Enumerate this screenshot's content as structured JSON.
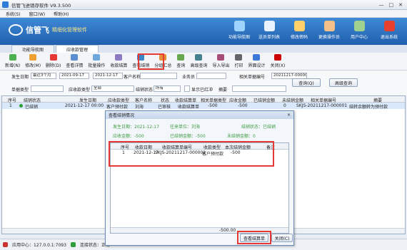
{
  "app": {
    "title": "信管飞进销存软件 V9.3.500",
    "menu": [
      "系统(S)",
      "窗口(W)",
      "帮助(H)"
    ]
  },
  "banner": {
    "brand": "信管飞",
    "slogan": "精细化管理软件",
    "buttons": [
      "功能导航图",
      "送员单列表",
      "修改密码",
      "更换操作员",
      "用户中心",
      "退出系统"
    ]
  },
  "tabs": [
    "功能导航图",
    "应收款管理"
  ],
  "toolbar": {
    "buttons": [
      "新增(N)",
      "修改(M)",
      "删除(D)",
      "查看详情",
      "批量操作",
      "收款结算",
      "查看结销",
      "分组汇总",
      "查询",
      "高级查询",
      "导入导出",
      "打印",
      "界面设计",
      "关闭(X)"
    ]
  },
  "filter": {
    "date_label": "发生日期",
    "date_range": "最近3个月",
    "date_from": "2021-09-17",
    "date_to": "2021-12-17",
    "customer_label": "客户名称",
    "salesman_label": "业务员",
    "ref_label": "相关单据编号",
    "ref_value": "20211217-000001",
    "query_btn": "查询(Q)",
    "adv_btn": "高级查询",
    "doc_type_label": "单据类型",
    "recv_type_label": "应收款类型",
    "recv_type_value": "全部",
    "status_label": "结销状态",
    "status_value": "所有",
    "show_label": "显示已红冲",
    "remark_label": "摘要"
  },
  "table": {
    "headers": [
      "序号",
      "结销状态",
      "发生日期",
      "应收款类型",
      "客户名称",
      "状态",
      "收款结算单",
      "相关单据类型",
      "应收金额",
      "已结销金额",
      "未结销金额",
      "相关单据编号",
      "摘要"
    ],
    "rows": [
      [
        "1",
        "已结销",
        "2021-12-17 00:00",
        "客户预付款",
        "刘海",
        "已审核",
        "收款结算单",
        "-500",
        "-500",
        "0",
        "SKJS-20211217-000001",
        "结转余额转为预付款"
      ]
    ]
  },
  "dialog": {
    "title": "查看结销情况",
    "close": "×",
    "info": [
      {
        "label": "发生日期：",
        "value": "2021-12-17"
      },
      {
        "label": "往来单位：",
        "value": "刘海"
      },
      {
        "label": "结销状态：",
        "value": "已结销"
      },
      {
        "label": "应收金额：",
        "value": "-500"
      },
      {
        "label": "已结销金额：",
        "value": "-500"
      },
      {
        "label": "未结销金额：",
        "value": "0"
      }
    ],
    "headers": [
      "序号",
      "收款日期",
      "收款结算单编号",
      "收款类型",
      "本次结销金额",
      "备注"
    ],
    "rows": [
      [
        "1",
        "2021-12-17",
        "SKJS-20211217-000002",
        "客户预付款",
        "-500",
        ""
      ]
    ],
    "footer_total": "-500.00",
    "view_btn": "查看结算单",
    "close_btn": "关闭(C)"
  },
  "status": {
    "server": "应用中心：127.0.0.1:7093",
    "connection": "连接状态：正常"
  }
}
